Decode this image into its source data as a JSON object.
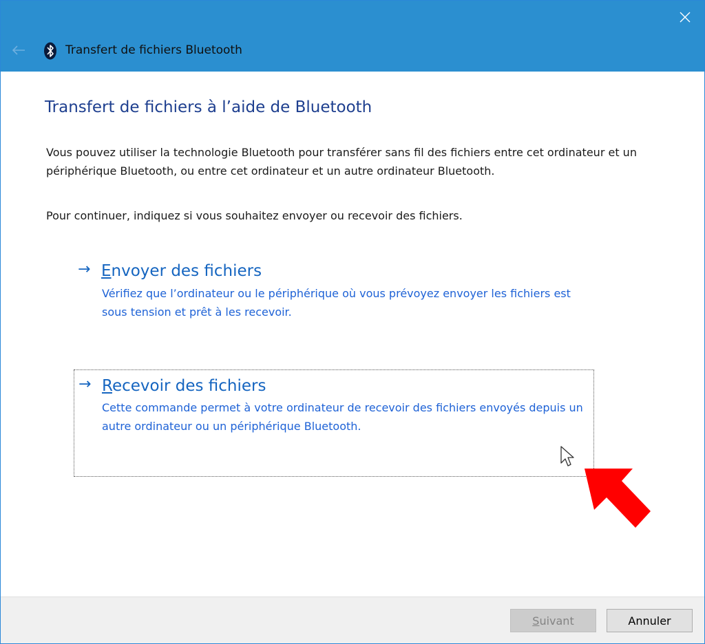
{
  "window": {
    "title": "Transfert de fichiers Bluetooth"
  },
  "main": {
    "heading": "Transfert de fichiers à l’aide de Bluetooth",
    "description": "Vous pouvez utiliser la technologie Bluetooth pour transférer sans fil des fichiers entre cet ordinateur et un périphérique Bluetooth, ou entre cet ordinateur et un autre ordinateur Bluetooth.",
    "instruction": "Pour continuer, indiquez si vous souhaitez envoyer ou recevoir des fichiers.",
    "options": {
      "send": {
        "arrow": "→",
        "title_first": "E",
        "title_rest": "nvoyer des fichiers",
        "description": "Vérifiez que l’ordinateur ou le périphérique où vous prévoyez envoyer les fichiers est sous tension et prêt à les recevoir."
      },
      "receive": {
        "arrow": "→",
        "title_first": "R",
        "title_rest": "ecevoir des fichiers",
        "description": "Cette commande permet à votre ordinateur de recevoir des fichiers envoyés depuis un autre ordinateur ou un périphérique Bluetooth."
      }
    }
  },
  "footer": {
    "next_first": "S",
    "next_rest": "uivant",
    "cancel_label": "Annuler"
  },
  "colors": {
    "titlebar": "#2b8fd0",
    "heading": "#1e3f8f",
    "link": "#1565c0",
    "highlight_arrow": "#ff0000"
  },
  "icons": {
    "close": "close-icon",
    "back": "back-arrow-icon",
    "bluetooth": "bluetooth-icon",
    "pointer": "mouse-pointer-icon",
    "annotation": "red-arrow-icon"
  }
}
